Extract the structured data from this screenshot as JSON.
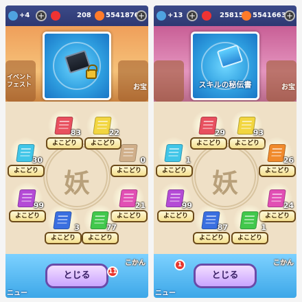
{
  "colors": {
    "red": "#e8505f",
    "yellow": "#f2d640",
    "cyan": "#41c6e8",
    "purple": "#b44bd6",
    "blue": "#3a6fe0",
    "green": "#42c84c",
    "orange": "#f08a2c",
    "pink": "#e14fb4"
  },
  "panels": [
    {
      "status": {
        "left_value": "+4",
        "coins": "208",
        "money": "5541870"
      },
      "event_label": "イベント フェスト",
      "side_badge": "お宝",
      "reward": {
        "name": "",
        "locked": true
      },
      "emblem_glyph": "妖",
      "items": [
        {
          "count": "83",
          "button": "よこどり",
          "color": "red"
        },
        {
          "count": "22",
          "button": "よこどり",
          "color": "yellow"
        },
        {
          "count": "30",
          "button": "よこどり",
          "color": "cyan"
        },
        {
          "count": "0",
          "button": "よこどり",
          "color": "locked"
        },
        {
          "count": "99",
          "button": "よこどり",
          "color": "purple"
        },
        {
          "count": "21",
          "button": "よこどり",
          "color": "pink"
        },
        {
          "count": "3",
          "button": "よこどり",
          "color": "blue"
        },
        {
          "count": "77",
          "button": "よこどり",
          "color": "green"
        }
      ],
      "close_button": "とじる",
      "menu_label": "ニュー",
      "notif": "11",
      "corner_label": "こかん"
    },
    {
      "status": {
        "left_value": "+13",
        "coins": "25815",
        "money": "5541663"
      },
      "event_label": "",
      "side_badge": "お宝",
      "reward": {
        "name": "スキルの秘伝書",
        "locked": false
      },
      "emblem_glyph": "妖",
      "items": [
        {
          "count": "29",
          "button": "よこどり",
          "color": "red"
        },
        {
          "count": "93",
          "button": "よこどり",
          "color": "yellow"
        },
        {
          "count": "1",
          "button": "よこどり",
          "color": "cyan"
        },
        {
          "count": "26",
          "button": "よこどり",
          "color": "orange"
        },
        {
          "count": "99",
          "button": "よこどり",
          "color": "purple"
        },
        {
          "count": "24",
          "button": "よこどり",
          "color": "pink"
        },
        {
          "count": "87",
          "button": "よこどり",
          "color": "blue"
        },
        {
          "count": "1",
          "button": "よこどり",
          "color": "green"
        }
      ],
      "close_button": "とじる",
      "menu_label": "ニュー",
      "notif": "1",
      "corner_label": "こかん"
    }
  ]
}
